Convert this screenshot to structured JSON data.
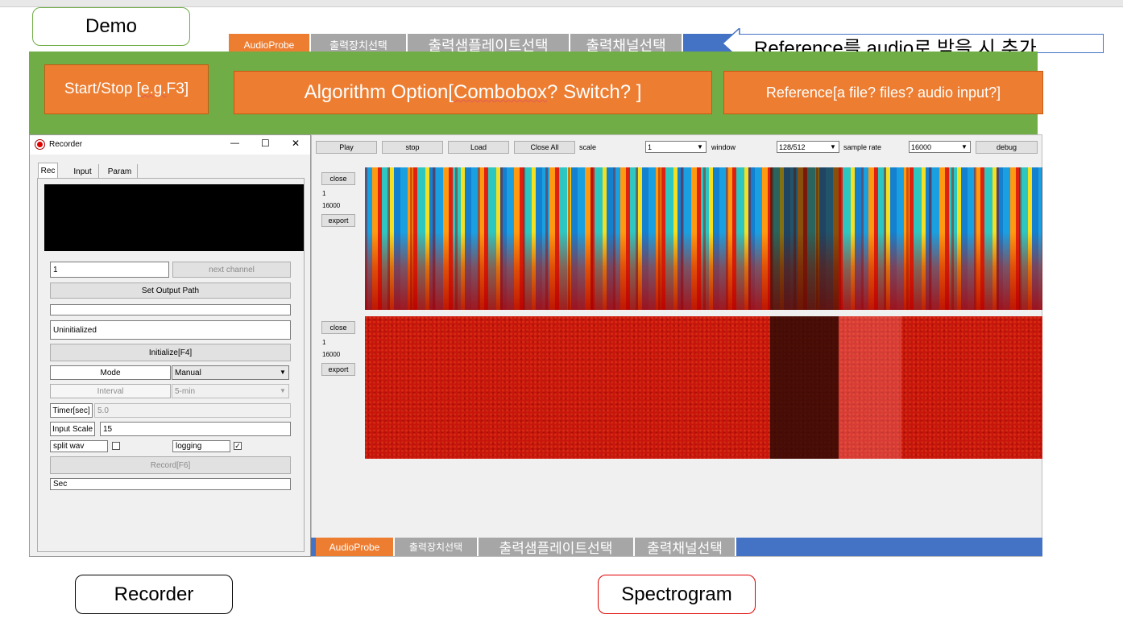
{
  "labels": {
    "demo": "Demo",
    "recorder": "Recorder",
    "spectrogram": "Spectrogram"
  },
  "demo_panel": {
    "start_stop": "Start/Stop [",
    "start_stop_eg": "e.g.",
    "start_stop_key": " F3]",
    "algorithm_prefix": "Algorithm Option[",
    "algorithm_combobox": "Combobox",
    "algorithm_suffix": "? Switch? ]",
    "reference": "Reference[a file? files? audio input?]"
  },
  "top_tabbar": {
    "tabs": [
      "AudioProbe",
      "출력장치선택",
      "출력샘플레이트선택",
      "출력채널선택"
    ]
  },
  "reference_note": "Reference를 audio로 받을 시 추가",
  "bottom_tabbar": {
    "tabs": [
      "AudioProbe",
      "출력장치선택",
      "출력샘플레이트선택",
      "출력채널선택"
    ]
  },
  "recorder_window": {
    "title": "Recorder",
    "controls": {
      "minimize": "—",
      "maximize": "☐",
      "close": "✕"
    },
    "tabs": [
      "Rec",
      "Input",
      "Param"
    ],
    "channel_value": "1",
    "next_channel": "next channel",
    "set_output_path": "Set Output Path",
    "output_path_value": "",
    "status": "Uninitialized",
    "initialize": "Initialize[F4]",
    "mode_label": "Mode",
    "mode_value": "Manual",
    "interval_label": "Interval",
    "interval_value": "5-min",
    "timer_label": "Timer[sec]",
    "timer_value": "5.0",
    "input_scale_label": "Input Scale",
    "input_scale_value": "15",
    "split_wav_label": "split wav",
    "split_wav_checked": false,
    "logging_label": "logging",
    "logging_checked": true,
    "record": "Record[F6]",
    "sec_value": "Sec"
  },
  "spectrogram_window": {
    "toolbar": {
      "play": "Play",
      "stop": "stop",
      "load": "Load",
      "close_all": "Close All",
      "scale_label": "scale",
      "scale_value": "1",
      "window_label": "window",
      "window_value": "128/512",
      "sample_rate_label": "sample rate",
      "sample_rate_value": "16000",
      "debug": "debug"
    },
    "panels": [
      {
        "close": "close",
        "channel": "1",
        "rate": "16000",
        "export": "export"
      },
      {
        "close": "close",
        "channel": "1",
        "rate": "16000",
        "export": "export"
      }
    ]
  },
  "colors": {
    "green": "#70ad47",
    "orange": "#ed7d31",
    "blue": "#4472c4",
    "gray_tab": "#a6a6a6"
  }
}
